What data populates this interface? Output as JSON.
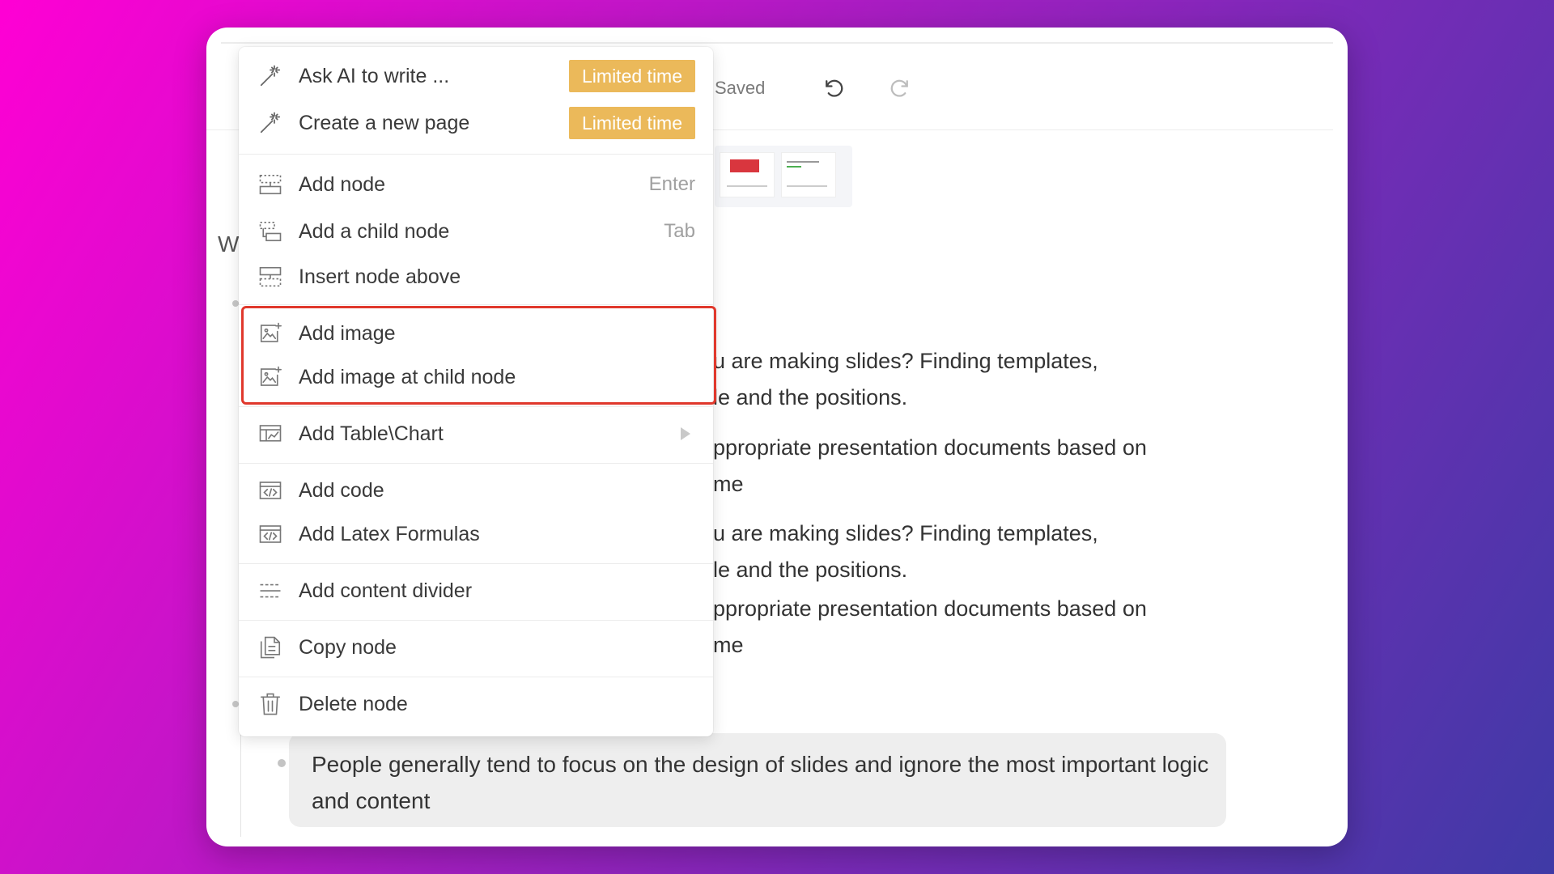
{
  "toolbar": {
    "saved_label": "Saved",
    "undo_icon": "undo-icon",
    "redo_icon": "redo-icon"
  },
  "document": {
    "partial_heading": "W",
    "lines": [
      "u are making slides? Finding templates,",
      "le and the positions.",
      "ppropriate presentation documents based on",
      "me",
      "u are making slides? Finding templates,",
      "le and the positions.",
      "ppropriate presentation documents based on",
      "me"
    ],
    "bottom_text": "People generally tend to focus on the design of slides and ignore the most important logic and content"
  },
  "menu": {
    "ai_items": [
      {
        "label": "Ask AI to write ...",
        "badge": "Limited time",
        "icon": "magic-wand-icon"
      },
      {
        "label": "Create a new page",
        "badge": "Limited time",
        "icon": "magic-wand-icon"
      }
    ],
    "node_items": [
      {
        "label": "Add node",
        "shortcut": "Enter",
        "icon": "add-node-icon"
      },
      {
        "label": "Add a child node",
        "shortcut": "Tab",
        "icon": "add-child-node-icon"
      },
      {
        "label": "Insert node above",
        "icon": "insert-above-icon"
      }
    ],
    "image_items": [
      {
        "label": "Add image",
        "icon": "add-image-icon"
      },
      {
        "label": "Add image at child node",
        "icon": "add-image-icon"
      }
    ],
    "table_item": {
      "label": "Add Table\\Chart",
      "icon": "table-chart-icon"
    },
    "code_items": [
      {
        "label": "Add code",
        "icon": "code-icon"
      },
      {
        "label": "Add Latex Formulas",
        "icon": "code-icon"
      }
    ],
    "divider_item": {
      "label": "Add content divider",
      "icon": "divider-icon"
    },
    "copy_item": {
      "label": "Copy node",
      "icon": "copy-icon"
    },
    "delete_item": {
      "label": "Delete node",
      "icon": "trash-icon"
    }
  },
  "colors": {
    "badge": "#ebb95a",
    "highlight": "#e0382c",
    "background_start": "#ff00d4",
    "background_end": "#3f3aa6"
  }
}
